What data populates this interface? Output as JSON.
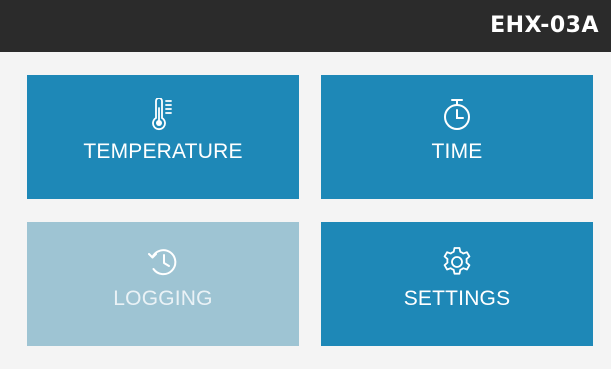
{
  "header": {
    "device_id": "EHX-03A"
  },
  "menu": {
    "temperature": {
      "label": "TEMPERATURE",
      "icon": "thermometer-icon"
    },
    "time": {
      "label": "TIME",
      "icon": "stopwatch-icon"
    },
    "logging": {
      "label": "LOGGING",
      "icon": "history-icon",
      "state": "disabled"
    },
    "settings": {
      "label": "SETTINGS",
      "icon": "gear-icon"
    }
  },
  "colors": {
    "header_bg": "#2b2b2b",
    "tile_active": "#1e88b7",
    "tile_disabled": "#9ec4d3",
    "page_bg": "#f4f4f4"
  }
}
